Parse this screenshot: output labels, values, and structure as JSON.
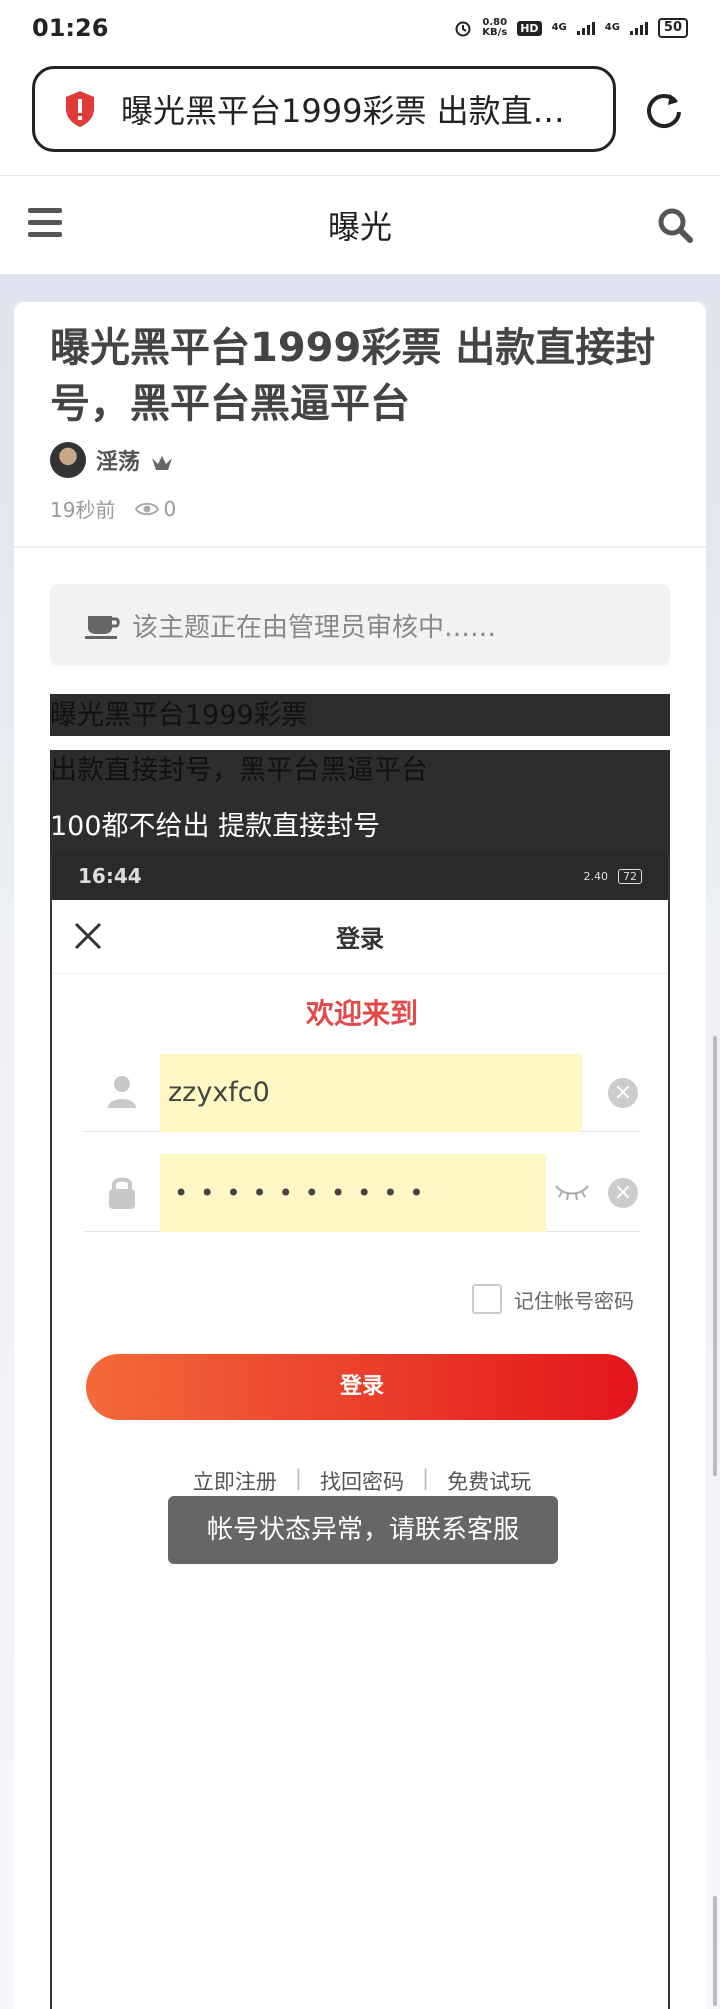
{
  "status_bar": {
    "time": "01:26",
    "net_speed_top": "0.80",
    "net_speed_unit": "KB/s",
    "hd": "HD",
    "signal1": "4G",
    "signal2": "4G",
    "battery": "50"
  },
  "browser": {
    "url_title": "曝光黑平台1999彩票 出款直…"
  },
  "site": {
    "title": "曝光"
  },
  "post": {
    "title": "曝光黑平台1999彩票 出款直接封号，黑平台黑逼平台",
    "author": "淫荡",
    "time_ago": "19秒前",
    "views": "0",
    "notice": "该主题正在由管理员审核中……",
    "line1": "曝光黑平台1999彩票",
    "line2": "出款直接封号，黑平台黑逼平台",
    "line3": "100都不给出 提款直接封号"
  },
  "embedded": {
    "time": "16:44",
    "speed": "2.40",
    "battery": "72",
    "header_title": "登录",
    "welcome": "欢迎来到",
    "username": "zzyxfc0",
    "password_dots": "••••••••••",
    "remember": "记住帐号密码",
    "login_button": "登录",
    "link_register": "立即注册",
    "link_forgot": "找回密码",
    "link_trial": "免费试玩",
    "toast": "帐号状态异常，请联系客服"
  },
  "colors": {
    "accent_red": "#e24a4a",
    "button_start": "#f26a3a",
    "button_end": "#e3151c",
    "input_highlight": "#fff8c4"
  }
}
